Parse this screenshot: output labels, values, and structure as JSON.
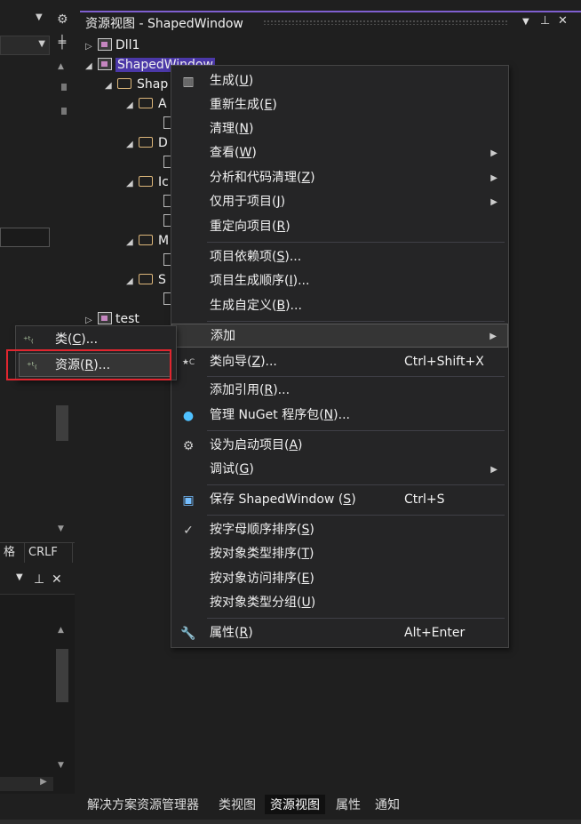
{
  "left_pane": {
    "status_cells": [
      "格",
      "CRLF"
    ]
  },
  "resource_view": {
    "title": "资源视图 - ShapedWindow",
    "tree": {
      "dll1": "Dll1",
      "shaped_window": "ShapedWindow",
      "shaped_folder": "Shap",
      "folder_a": "A",
      "folder_d": "D",
      "folder_i": "Ic",
      "folder_m": "M",
      "folder_s": "S",
      "test": "test"
    }
  },
  "context_menu": {
    "items": [
      {
        "label": "生成",
        "key": "U",
        "icon": "build-icon"
      },
      {
        "label": "重新生成",
        "key": "E"
      },
      {
        "label": "清理",
        "key": "N"
      },
      {
        "label": "查看",
        "key": "W",
        "submenu": true
      },
      {
        "label": "分析和代码清理",
        "key": "Z",
        "submenu": true
      },
      {
        "label": "仅用于项目",
        "key": "J",
        "submenu": true
      },
      {
        "label": "重定向项目",
        "key": "R"
      },
      {
        "label": "项目依赖项",
        "key": "S",
        "suffix": "..."
      },
      {
        "label": "项目生成顺序",
        "key": "I",
        "suffix": "..."
      },
      {
        "label": "生成自定义",
        "key": "B",
        "suffix": "..."
      },
      {
        "label": "添加",
        "submenu": true,
        "highlight": true
      },
      {
        "label": "类向导",
        "key": "Z",
        "suffix": "...",
        "shortcut": "Ctrl+Shift+X",
        "icon": "class-wizard-icon"
      },
      {
        "label": "添加引用",
        "key": "R",
        "suffix": "..."
      },
      {
        "label": "管理 NuGet 程序包",
        "key": "N",
        "suffix": "...",
        "icon": "nuget-icon"
      },
      {
        "label": "设为启动项目",
        "key": "A",
        "icon": "gear-icon"
      },
      {
        "label": "调试",
        "key": "G",
        "submenu": true
      },
      {
        "label": "保存 ShapedWindow ",
        "key": "S",
        "shortcut": "Ctrl+S",
        "icon": "save-icon"
      },
      {
        "label": "按字母顺序排序",
        "key": "S",
        "icon": "check-icon"
      },
      {
        "label": "按对象类型排序",
        "key": "T"
      },
      {
        "label": "按对象访问排序",
        "key": "E"
      },
      {
        "label": "按对象类型分组",
        "key": "U"
      },
      {
        "label": "属性",
        "key": "R",
        "shortcut": "Alt+Enter",
        "icon": "wrench-icon"
      }
    ]
  },
  "sub_menu": {
    "items": [
      {
        "label": "类",
        "key": "C",
        "suffix": "..."
      },
      {
        "label": "资源",
        "key": "R",
        "suffix": "..."
      }
    ]
  },
  "bottom_tabs": [
    "解决方案资源管理器",
    "类视图",
    "资源视图",
    "属性",
    "通知"
  ],
  "colors": {
    "accent": "#7f5fd0",
    "selection": "#4b38a8",
    "highlight_box": "#e0262f"
  }
}
